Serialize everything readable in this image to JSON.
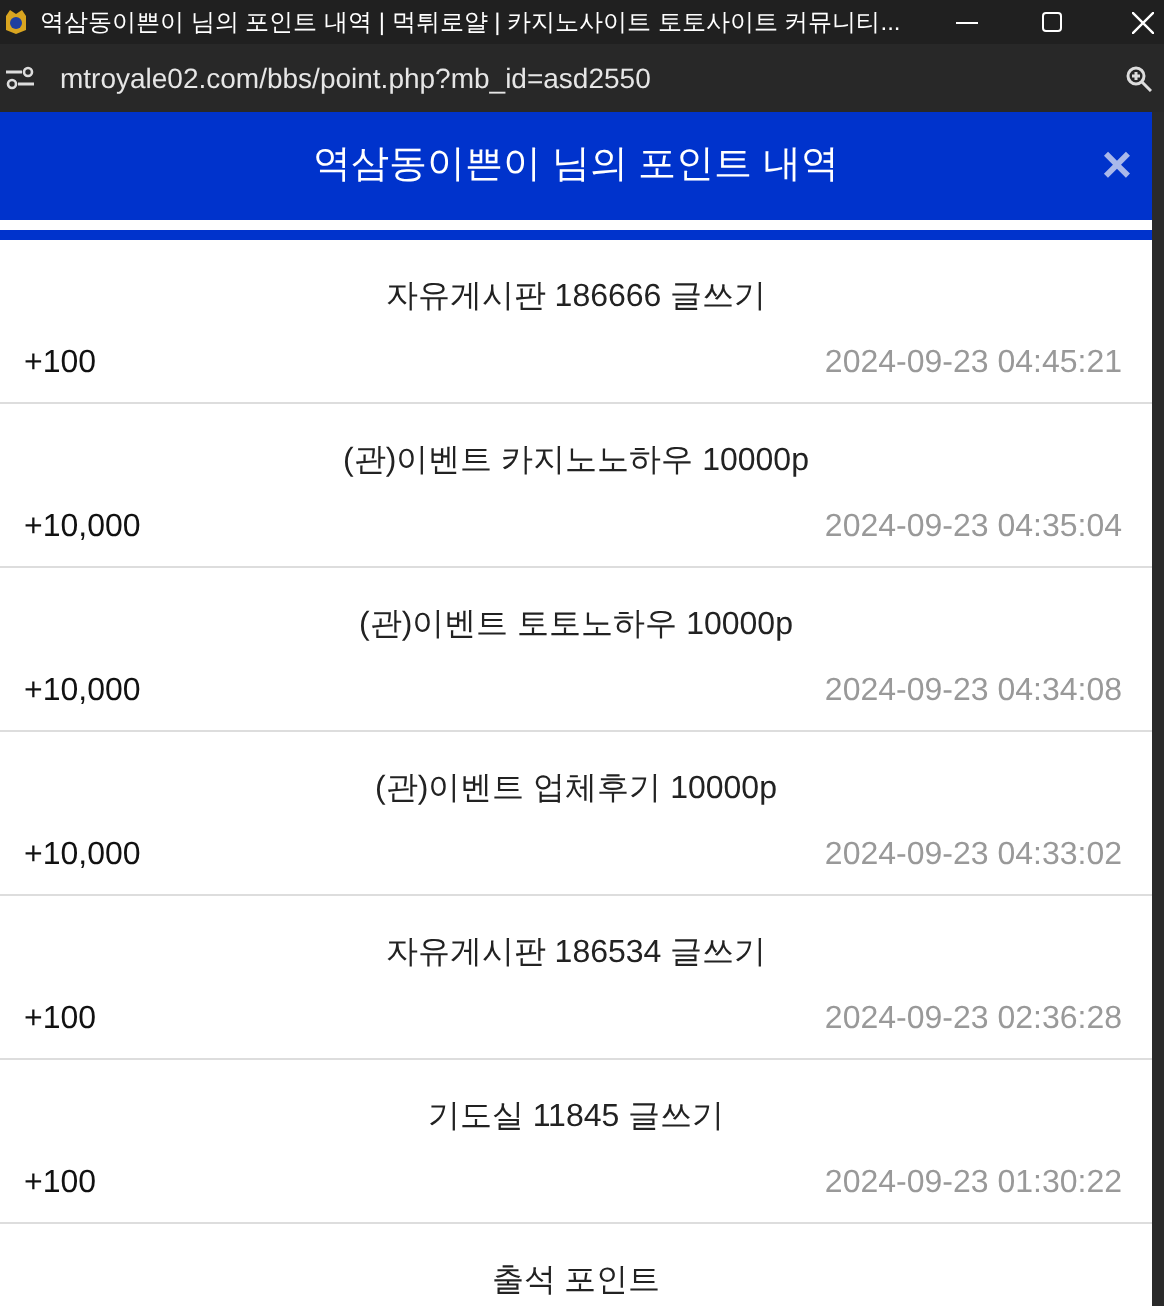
{
  "window": {
    "title": "역삼동이쁜이 님의 포인트 내역 | 먹튀로얄 | 카지노사이트 토토사이트 커뮤니티..."
  },
  "address_bar": {
    "url": "mtroyale02.com/bbs/point.php?mb_id=asd2550"
  },
  "header": {
    "title": "역삼동이쁜이 님의 포인트 내역",
    "close": "×"
  },
  "entries": [
    {
      "title": "자유게시판 186666 글쓰기",
      "amount": "+100",
      "datetime": "2024-09-23 04:45:21"
    },
    {
      "title": "(관)이벤트 카지노노하우 10000p",
      "amount": "+10,000",
      "datetime": "2024-09-23 04:35:04"
    },
    {
      "title": "(관)이벤트 토토노하우 10000p",
      "amount": "+10,000",
      "datetime": "2024-09-23 04:34:08"
    },
    {
      "title": "(관)이벤트 업체후기 10000p",
      "amount": "+10,000",
      "datetime": "2024-09-23 04:33:02"
    },
    {
      "title": "자유게시판 186534 글쓰기",
      "amount": "+100",
      "datetime": "2024-09-23 02:36:28"
    },
    {
      "title": "기도실 11845 글쓰기",
      "amount": "+100",
      "datetime": "2024-09-23 01:30:22"
    },
    {
      "title": "출석 포인트"
    }
  ]
}
